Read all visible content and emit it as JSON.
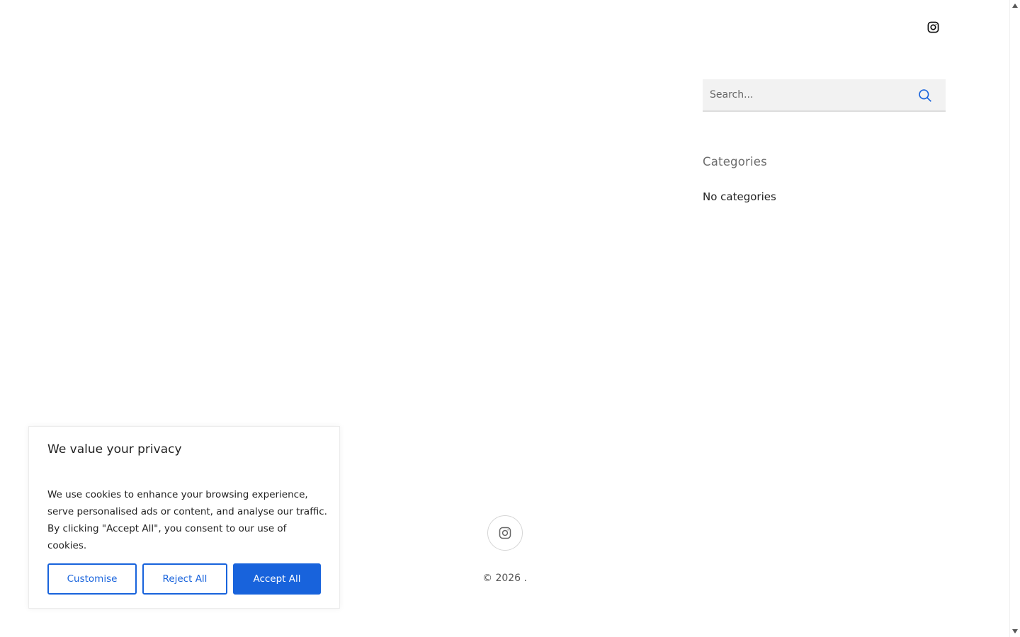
{
  "header": {
    "social_icon": "instagram-icon"
  },
  "sidebar": {
    "search": {
      "placeholder": "Search...",
      "icon": "search-icon",
      "accent_color": "#1863dc"
    },
    "categories": {
      "title": "Categories",
      "empty_text": "No categories"
    }
  },
  "footer": {
    "social_icon": "instagram-icon",
    "copyright": "© 2026 ."
  },
  "cookie_banner": {
    "title": "We value your privacy",
    "text": "We use cookies to enhance your browsing experience, serve personalised ads or content, and analyse our traffic. By clicking \"Accept All\", you consent to our use of cookies.",
    "buttons": {
      "customise": "Customise",
      "reject": "Reject All",
      "accept": "Accept All"
    },
    "button_color": "#1863dc"
  }
}
